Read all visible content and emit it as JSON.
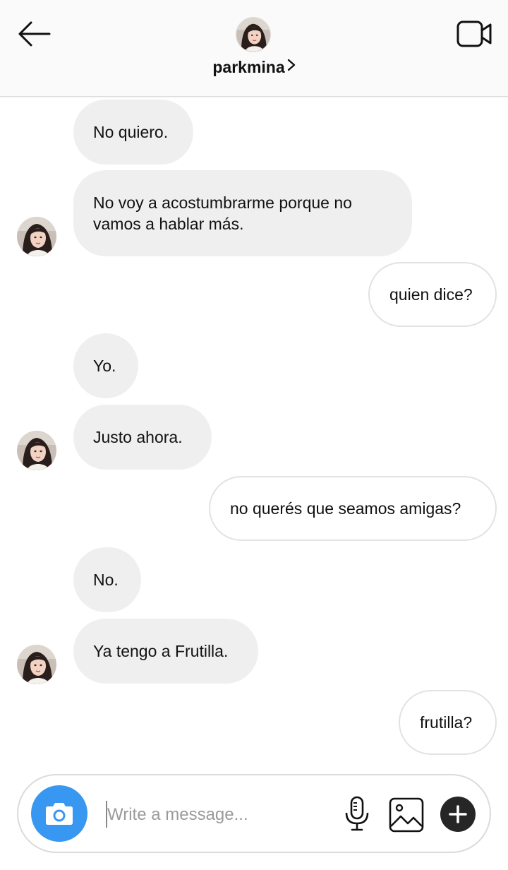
{
  "header": {
    "username": "parkmina"
  },
  "messages": [
    {
      "from": "them",
      "text": "No quiero."
    },
    {
      "from": "them",
      "text": "No voy a acostumbrarme porque no vamos a hablar más."
    },
    {
      "from": "me",
      "text": "quien dice?"
    },
    {
      "from": "them",
      "text": "Yo."
    },
    {
      "from": "them",
      "text": "Justo ahora."
    },
    {
      "from": "me",
      "text": "no querés que seamos amigas?"
    },
    {
      "from": "them",
      "text": "No."
    },
    {
      "from": "them",
      "text": "Ya tengo a Frutilla."
    },
    {
      "from": "me",
      "text": "frutilla?"
    }
  ],
  "composer": {
    "placeholder": "Write a message...",
    "value": ""
  },
  "colors": {
    "accent": "#3897f0",
    "incoming_bubble": "#efefef",
    "outgoing_border": "#e2e2e2",
    "plus_button": "#262626"
  },
  "icons": {
    "back": "arrow-left-icon",
    "video": "video-camera-icon",
    "chevron": "chevron-right-icon",
    "camera": "camera-icon",
    "mic": "microphone-icon",
    "gallery": "image-icon",
    "plus": "plus-icon"
  }
}
